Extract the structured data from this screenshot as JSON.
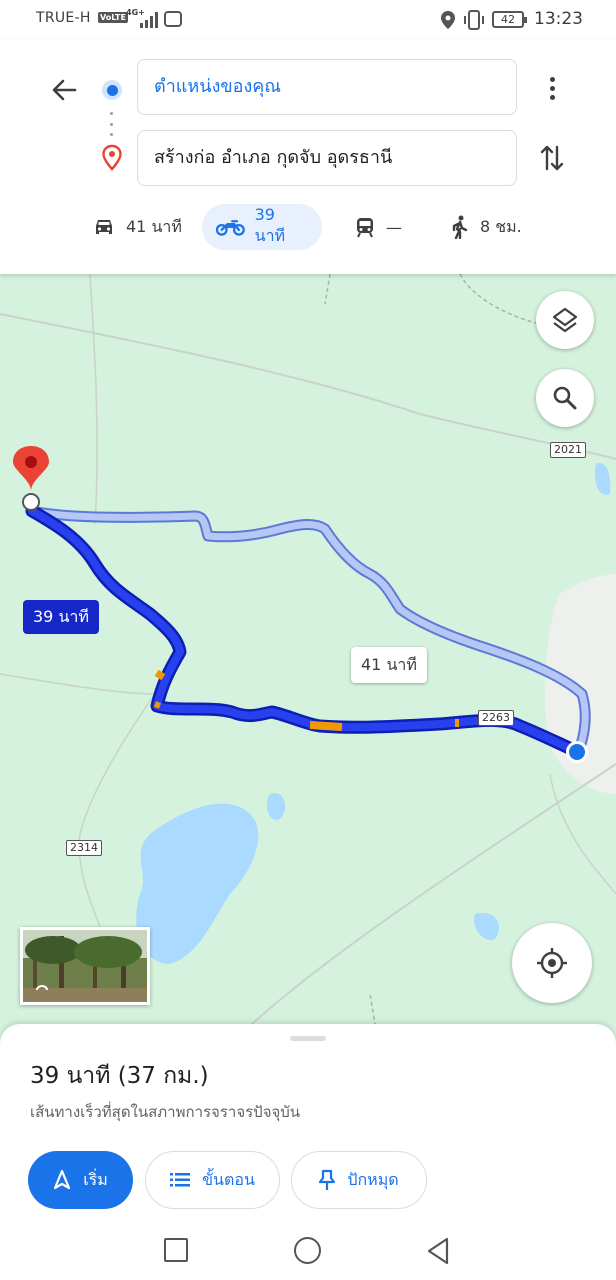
{
  "status_bar": {
    "carrier": "TRUE-H",
    "volte": "VoLTE",
    "network": "4G+",
    "battery": "42",
    "time": "13:23"
  },
  "directions": {
    "origin": "ตำแหน่งของคุณ",
    "destination": "สร้างก่อ อำเภอ กุดจับ อุดรธานี",
    "modes": [
      {
        "name": "drive",
        "label": "41 นาที",
        "icon": "car-icon",
        "active": false
      },
      {
        "name": "motorcycle",
        "label": "39 นาที",
        "icon": "motorcycle-icon",
        "active": true
      },
      {
        "name": "transit",
        "label": "—",
        "icon": "train-icon",
        "active": false
      },
      {
        "name": "walk",
        "label": "8 ชม.",
        "icon": "walk-icon",
        "active": false
      }
    ]
  },
  "map": {
    "primary_route_label": "39 นาที",
    "alt_route_label": "41 นาที",
    "road_shields": [
      "2021",
      "2263",
      "2314"
    ],
    "colors": {
      "primary_route": "#1627c8",
      "alt_route": "#b6c6f5",
      "traffic": "#f29900",
      "water": "#aadaff",
      "land": "#d4f2dd",
      "destination_pin": "#ea4335"
    }
  },
  "sheet": {
    "title": "39 นาที (37 กม.)",
    "subtitle": "เส้นทางเร็วที่สุดในสภาพการจราจรปัจจุบัน",
    "buttons": {
      "start": "เริ่ม",
      "steps": "ขั้นตอน",
      "pin": "ปักหมุด"
    }
  }
}
